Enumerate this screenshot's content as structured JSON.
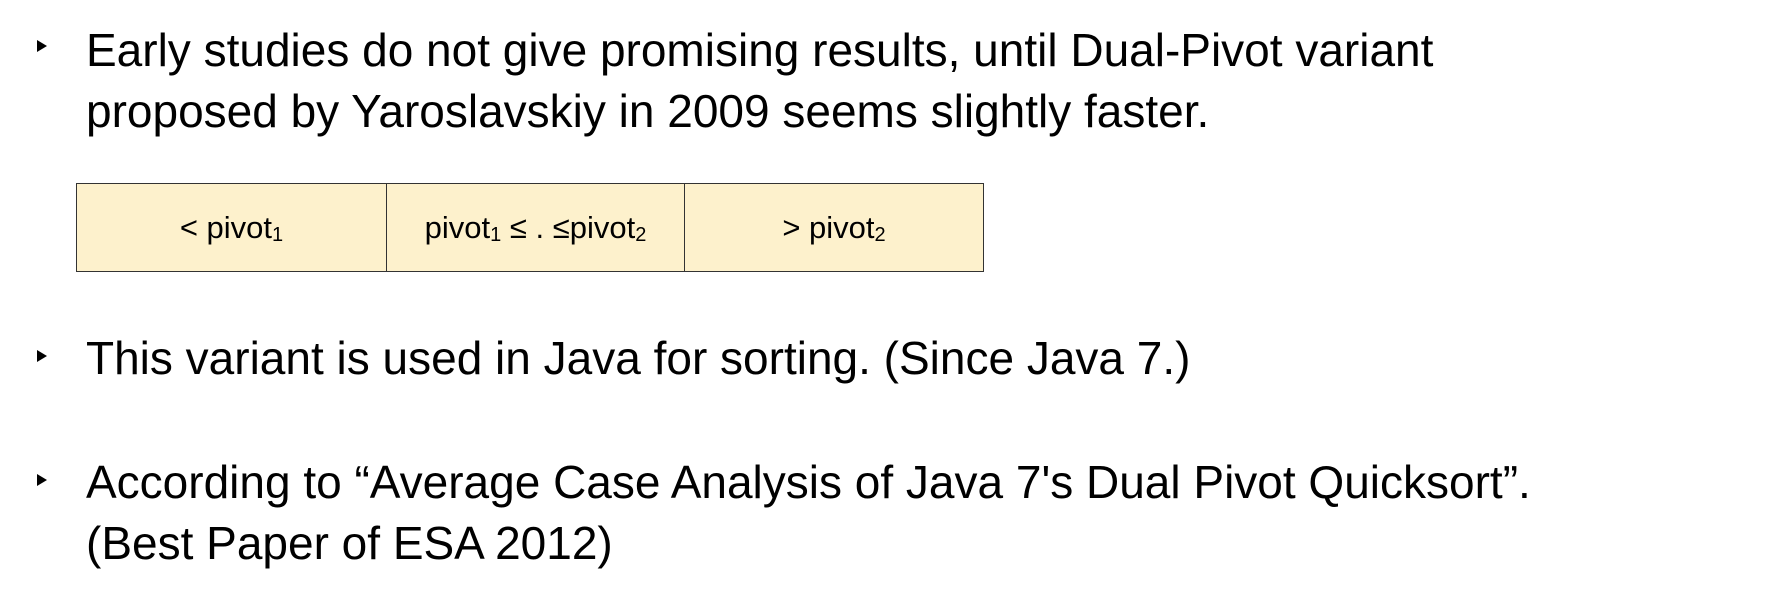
{
  "bullets": [
    {
      "lines": [
        "Early studies do not give promising results, until Dual-Pivot variant",
        "proposed by Yaroslavskiy in 2009 seems slightly faster."
      ]
    },
    {
      "lines": [
        "This variant is used in Java for sorting. (Since Java 7.)"
      ]
    },
    {
      "lines": [
        "According to “Average Case Analysis of Java 7's Dual Pivot Quicksort”.",
        "(Best Paper of ESA 2012)"
      ]
    }
  ],
  "partition": {
    "cell_fill": "#fdf1cc",
    "cells": [
      {
        "pre": "< pivot",
        "sub": "1",
        "post": "",
        "sub2": ""
      },
      {
        "pre": "pivot",
        "sub": "1",
        "post": " ≤ .  ≤pivot",
        "sub2": "2"
      },
      {
        "pre": "> pivot",
        "sub": "2",
        "post": "",
        "sub2": ""
      }
    ]
  }
}
